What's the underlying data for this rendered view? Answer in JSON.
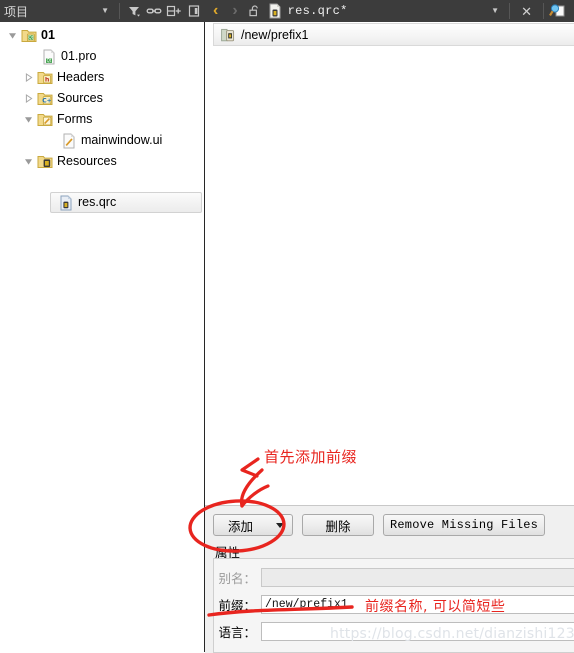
{
  "toolbar": {
    "panel_title": "项目",
    "title_dropdown_icon": "chevron-down-icon",
    "filter_icon": "filter-icon",
    "link_icon": "link-icon",
    "split_icon": "split-horizontal-icon",
    "sidebar_icon": "toggle-sidebar-icon",
    "back_icon": "chevron-left-icon",
    "forward_icon": "chevron-right-icon",
    "unlock_icon": "unlock-icon",
    "file_icon": "qrc-file-icon",
    "filename": "res.qrc*",
    "file_dropdown_icon": "chevron-down-icon",
    "close_icon": "close-icon",
    "search_icon": "search-document-icon"
  },
  "tree": {
    "items": [
      {
        "label": "01",
        "icon": "qt-project-folder-icon",
        "indent": 0,
        "expander": "expanded",
        "bold": true,
        "selected": false
      },
      {
        "label": "01.pro",
        "icon": "qt-pro-file-icon",
        "indent": 1,
        "expander": "none",
        "bold": false,
        "selected": false
      },
      {
        "label": "Headers",
        "icon": "headers-folder-icon",
        "indent": 1,
        "expander": "collapsed",
        "bold": false,
        "selected": false
      },
      {
        "label": "Sources",
        "icon": "sources-folder-icon",
        "indent": 1,
        "expander": "collapsed",
        "bold": false,
        "selected": false
      },
      {
        "label": "Forms",
        "icon": "forms-folder-icon",
        "indent": 1,
        "expander": "expanded",
        "bold": false,
        "selected": false
      },
      {
        "label": "mainwindow.ui",
        "icon": "ui-file-icon",
        "indent": 2,
        "expander": "none",
        "bold": false,
        "selected": false
      },
      {
        "label": "Resources",
        "icon": "resources-folder-icon",
        "indent": 1,
        "expander": "expanded",
        "bold": false,
        "selected": false
      },
      {
        "label": "res.qrc",
        "icon": "qrc-file-icon",
        "indent": 2,
        "expander": "none",
        "bold": false,
        "selected": true
      }
    ]
  },
  "main": {
    "prefix_row": {
      "icon": "prefix-folder-icon",
      "label": "/new/prefix1"
    }
  },
  "bottom": {
    "add_button": "添加",
    "add_button_caret_icon": "caret-down-icon",
    "delete_button": "删除",
    "remove_missing_button": "Remove Missing Files",
    "properties_label": "属性",
    "fields": [
      {
        "label": "别名：",
        "value": "",
        "disabled": true
      },
      {
        "label": "前缀：",
        "value": "/new/prefix1",
        "disabled": false
      },
      {
        "label": "语言：",
        "value": "",
        "disabled": false
      }
    ]
  },
  "annotations": {
    "color": "#e8251f",
    "note_add_prefix": "首先添加前缀",
    "note_prefix_name": "前缀名称, 可以简短些"
  },
  "watermark": {
    "text": "https://blog.csdn.net/dianzishi123"
  }
}
